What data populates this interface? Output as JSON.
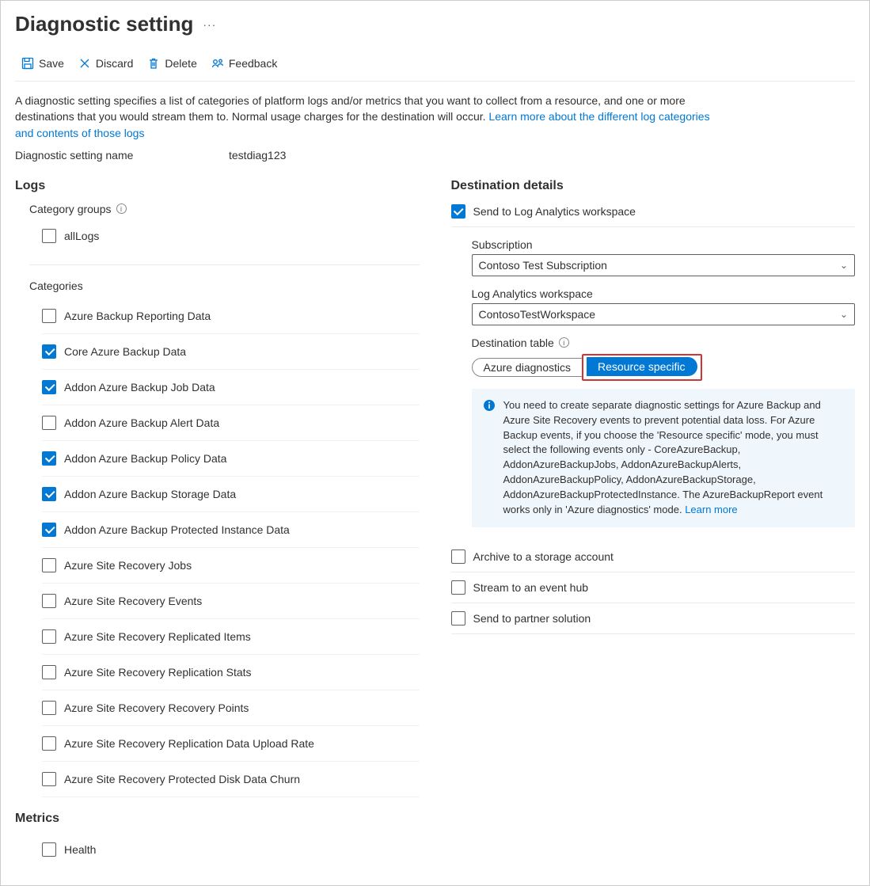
{
  "header": {
    "title": "Diagnostic setting"
  },
  "toolbar": {
    "save": "Save",
    "discard": "Discard",
    "delete": "Delete",
    "feedback": "Feedback"
  },
  "desc": {
    "text": "A diagnostic setting specifies a list of categories of platform logs and/or metrics that you want to collect from a resource, and one or more destinations that you would stream them to. Normal usage charges for the destination will occur. ",
    "link": "Learn more about the different log categories and contents of those logs"
  },
  "nameField": {
    "label": "Diagnostic setting name",
    "value": "testdiag123"
  },
  "logs": {
    "heading": "Logs",
    "groupsLabel": "Category groups",
    "groups": [
      {
        "label": "allLogs",
        "checked": false
      }
    ],
    "categoriesLabel": "Categories",
    "categories": [
      {
        "label": "Azure Backup Reporting Data",
        "checked": false
      },
      {
        "label": "Core Azure Backup Data",
        "checked": true
      },
      {
        "label": "Addon Azure Backup Job Data",
        "checked": true
      },
      {
        "label": "Addon Azure Backup Alert Data",
        "checked": false
      },
      {
        "label": "Addon Azure Backup Policy Data",
        "checked": true
      },
      {
        "label": "Addon Azure Backup Storage Data",
        "checked": true
      },
      {
        "label": "Addon Azure Backup Protected Instance Data",
        "checked": true
      },
      {
        "label": "Azure Site Recovery Jobs",
        "checked": false
      },
      {
        "label": "Azure Site Recovery Events",
        "checked": false
      },
      {
        "label": "Azure Site Recovery Replicated Items",
        "checked": false
      },
      {
        "label": "Azure Site Recovery Replication Stats",
        "checked": false
      },
      {
        "label": "Azure Site Recovery Recovery Points",
        "checked": false
      },
      {
        "label": "Azure Site Recovery Replication Data Upload Rate",
        "checked": false
      },
      {
        "label": "Azure Site Recovery Protected Disk Data Churn",
        "checked": false
      }
    ]
  },
  "metrics": {
    "heading": "Metrics",
    "items": [
      {
        "label": "Health",
        "checked": false
      }
    ]
  },
  "dest": {
    "heading": "Destination details",
    "sendLA": {
      "label": "Send to Log Analytics workspace",
      "checked": true
    },
    "subscription": {
      "label": "Subscription",
      "value": "Contoso Test Subscription"
    },
    "workspace": {
      "label": "Log Analytics workspace",
      "value": "ContosoTestWorkspace"
    },
    "destTable": {
      "label": "Destination table"
    },
    "pillA": "Azure diagnostics",
    "pillB": "Resource specific",
    "banner": "You need to create separate diagnostic settings for Azure Backup and Azure Site Recovery events to prevent potential data loss. For Azure Backup events, if you choose the 'Resource specific' mode, you must select the following events only - CoreAzureBackup, AddonAzureBackupJobs, AddonAzureBackupAlerts, AddonAzureBackupPolicy, AddonAzureBackupStorage, AddonAzureBackupProtectedInstance. The AzureBackupReport event works only in 'Azure diagnostics' mode.  ",
    "bannerLink": "Learn more",
    "archive": {
      "label": "Archive to a storage account",
      "checked": false
    },
    "stream": {
      "label": "Stream to an event hub",
      "checked": false
    },
    "partner": {
      "label": "Send to partner solution",
      "checked": false
    }
  }
}
